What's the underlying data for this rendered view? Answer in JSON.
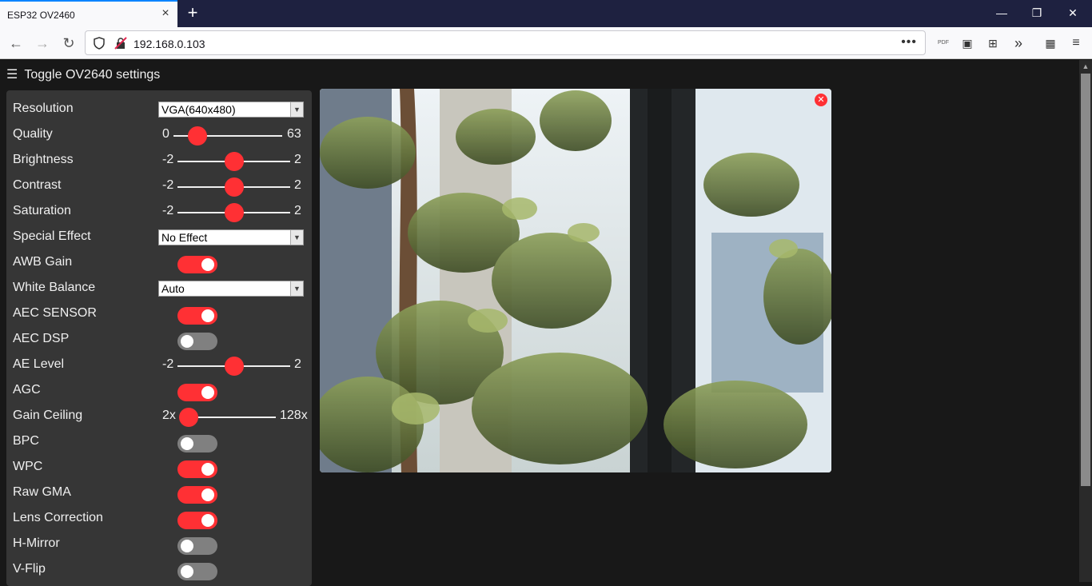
{
  "browser": {
    "tab_title": "ESP32 OV2460",
    "url": "192.168.0.103",
    "page_actions": "•••",
    "extension_label": "PDF"
  },
  "header": {
    "toggle_label": "Toggle OV2640 settings"
  },
  "settings": {
    "resolution": {
      "label": "Resolution",
      "value": "VGA(640x480)"
    },
    "quality": {
      "label": "Quality",
      "min": "0",
      "max": "63",
      "value": 10
    },
    "brightness": {
      "label": "Brightness",
      "min": "-2",
      "max": "2",
      "value": 0
    },
    "contrast": {
      "label": "Contrast",
      "min": "-2",
      "max": "2",
      "value": 0
    },
    "saturation": {
      "label": "Saturation",
      "min": "-2",
      "max": "2",
      "value": 0
    },
    "special_effect": {
      "label": "Special Effect",
      "value": "No Effect"
    },
    "awb_gain": {
      "label": "AWB Gain",
      "on": true
    },
    "white_balance": {
      "label": "White Balance",
      "value": "Auto"
    },
    "aec_sensor": {
      "label": "AEC SENSOR",
      "on": true
    },
    "aec_dsp": {
      "label": "AEC DSP",
      "on": false
    },
    "ae_level": {
      "label": "AE Level",
      "min": "-2",
      "max": "2",
      "value": 0
    },
    "agc": {
      "label": "AGC",
      "on": true
    },
    "gain_ceiling": {
      "label": "Gain Ceiling",
      "min": "2x",
      "max": "128x",
      "value": 0
    },
    "bpc": {
      "label": "BPC",
      "on": false
    },
    "wpc": {
      "label": "WPC",
      "on": true
    },
    "raw_gma": {
      "label": "Raw GMA",
      "on": true
    },
    "lens_correction": {
      "label": "Lens Correction",
      "on": true
    },
    "h_mirror": {
      "label": "H-Mirror",
      "on": false
    },
    "v_flip": {
      "label": "V-Flip",
      "on": false
    }
  },
  "colors": {
    "accent": "#ff3034",
    "panel": "#363636",
    "background": "#181818"
  }
}
